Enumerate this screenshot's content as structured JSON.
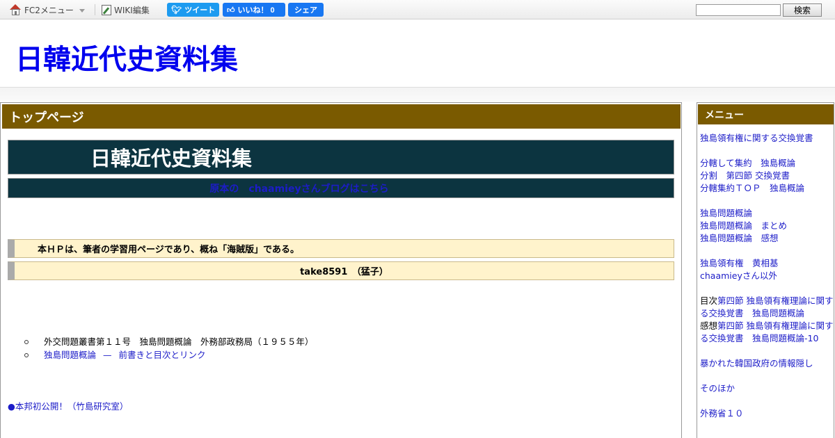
{
  "toolbar": {
    "fc2_menu": "FC2メニュー",
    "wiki_edit": "WIKI編集",
    "tweet": "ツイート",
    "like": "いいね！ 0",
    "share": "シェア",
    "search_button": "検索",
    "search_value": ""
  },
  "header": {
    "site_title": "日韓近代史資料集"
  },
  "main": {
    "heading": "トップページ",
    "banner_title": "日韓近代史資料集",
    "banner_link": "原本の　chaamieyさんブログはこちら",
    "note1": "本ＨＰは、筆者の学習用ページであり、概ね「海賊版」である。",
    "note2": "take8591　（猛子）",
    "list": {
      "item1": "外交問題叢書第１１号　独島問題概論　外務部政務局（１９５５年）",
      "item2_link_a": "独島問題概論",
      "item2_dash": "—",
      "item2_link_b": "前書きと目次とリンク"
    },
    "bottom_link": "●本邦初公開！（竹島研究室）"
  },
  "sidebar": {
    "heading": "メニュー",
    "items": [
      "独島領有権に関する交換覚書",
      "分轄して集約　独島概論",
      "分割　第四節 交換覚書",
      "分轄集約ＴＯＰ　独島概論",
      "独島問題概論",
      "独島問題概論　まとめ",
      "独島問題概論　感想",
      "独島領有権　黄相基",
      "chaamieyさん以外",
      "目次",
      "第四節 独島領有権理論に関する交換覚書　独島問題概論",
      "感想",
      "第四節 独島領有権理論に関する交換覚書　独島問題概論-10",
      "暴かれた韓国政府の情報隠し",
      "そのほか",
      "外務省１０"
    ]
  }
}
